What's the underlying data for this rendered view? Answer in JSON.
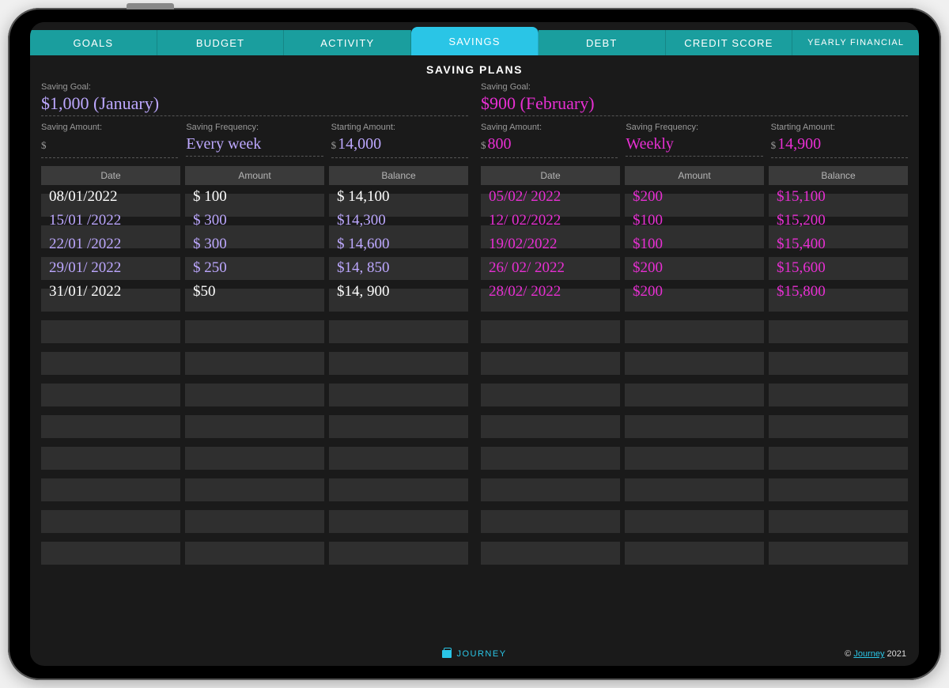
{
  "tabs": [
    {
      "label": "GOALS",
      "active": false
    },
    {
      "label": "BUDGET",
      "active": false
    },
    {
      "label": "ACTIVITY",
      "active": false
    },
    {
      "label": "SAVINGS",
      "active": true
    },
    {
      "label": "DEBT",
      "active": false
    },
    {
      "label": "CREDIT SCORE",
      "active": false
    },
    {
      "label": "YEARLY FINANCIAL",
      "active": false
    }
  ],
  "page_title": "SAVING PLANS",
  "labels": {
    "saving_goal": "Saving Goal:",
    "saving_amount": "Saving Amount:",
    "saving_frequency": "Saving Frequency:",
    "starting_amount": "Starting Amount:",
    "dollar": "$"
  },
  "columns": [
    "Date",
    "Amount",
    "Balance"
  ],
  "row_count": 12,
  "plans": [
    {
      "ink": "lavender",
      "goal": "$1,000 (January)",
      "saving_amount": "",
      "saving_frequency": "Every week",
      "starting_amount": "14,000",
      "entries": [
        {
          "date": "08/01/2022",
          "amount": "$ 100",
          "balance": "$ 14,100",
          "ink": "white"
        },
        {
          "date": "15/01 /2022",
          "amount": "$ 300",
          "balance": "$14,300",
          "ink": "lavender"
        },
        {
          "date": "22/01 /2022",
          "amount": "$ 300",
          "balance": "$ 14,600",
          "ink": "lavender"
        },
        {
          "date": "29/01/ 2022",
          "amount": "$ 250",
          "balance": "$14, 850",
          "ink": "lavender"
        },
        {
          "date": "31/01/ 2022",
          "amount": "$50",
          "balance": "$14, 900",
          "ink": "white"
        }
      ]
    },
    {
      "ink": "magenta",
      "goal": "$900 (February)",
      "saving_amount": "800",
      "saving_frequency": "Weekly",
      "starting_amount": "14,900",
      "entries": [
        {
          "date": "05/02/ 2022",
          "amount": "$200",
          "balance": "$15,100",
          "ink": "magenta"
        },
        {
          "date": "12/ 02/2022",
          "amount": "$100",
          "balance": "$15,200",
          "ink": "magenta"
        },
        {
          "date": "19/02/2022",
          "amount": "$100",
          "balance": "$15,400",
          "ink": "magenta"
        },
        {
          "date": "26/ 02/ 2022",
          "amount": "$200",
          "balance": "$15,600",
          "ink": "magenta"
        },
        {
          "date": "28/02/ 2022",
          "amount": "$200",
          "balance": "$15,800",
          "ink": "magenta"
        }
      ]
    }
  ],
  "footer": {
    "brand": "JOURNEY",
    "copyright_prefix": "© ",
    "copyright_link": "Journey",
    "copyright_year": " 2021"
  }
}
